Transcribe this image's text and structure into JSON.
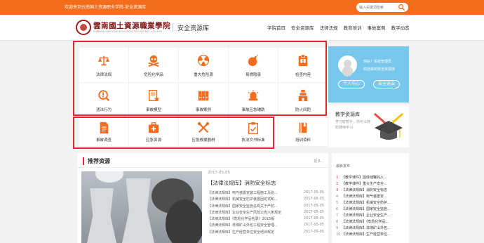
{
  "topbar": {
    "welcome": "欢迎来到云南国土资源职业学院-安全资源库",
    "search_placeholder": "输入关键词检索",
    "color": "#f36d1c"
  },
  "header": {
    "school_name": "雲南國土資源職業學院",
    "school_en": "YUNNAN LAND AND RESOURCES VOCATIONAL COLLEGE",
    "site_name": "安全资源库",
    "nav": [
      "学院首页",
      "安全资源库",
      "法律法规",
      "教育培训",
      "事故案例",
      "教学动态"
    ]
  },
  "tiles": [
    {
      "label": "法律法规",
      "icon": "scale-icon"
    },
    {
      "label": "危险化学品",
      "icon": "skull-crossbones-icon"
    },
    {
      "label": "重大危险源",
      "icon": "radiation-icon"
    },
    {
      "label": "易燃隐患",
      "icon": "bomb-icon"
    },
    {
      "label": "检查内容",
      "icon": "clipboard-check-icon"
    },
    {
      "label": "违法行为",
      "icon": "magnifier-warning-icon"
    },
    {
      "label": "事故模型",
      "icon": "document-star-icon"
    },
    {
      "label": "事故案例",
      "icon": "binders-icon"
    },
    {
      "label": "事故应急辅助",
      "icon": "alarm-light-icon"
    },
    {
      "label": "防火间距",
      "icon": "building-icon"
    },
    {
      "label": "事故调查",
      "icon": "report-document-icon"
    },
    {
      "label": "应急资源",
      "icon": "first-aid-kit-icon"
    },
    {
      "label": "应急救援器材",
      "icon": "tools-icon"
    },
    {
      "label": "执法文书标准",
      "icon": "clipboard-checklist-icon"
    },
    {
      "label": "培训资料",
      "icon": "book-bookmark-icon"
    }
  ],
  "user": {
    "greeting": "你好！系统管理员",
    "role": "欢迎来到安全资源库",
    "center_btn": "个人中心",
    "logout_btn": "安全退出"
  },
  "resource": {
    "title": "教学资源库",
    "desc": "学习好帮手，你可以随时随地学习"
  },
  "recommend": {
    "title": "推荐资源",
    "more": "更多...",
    "featured_date": "2017-05-05",
    "featured_title": "【法律法规库】消防安全标志",
    "items": [
      {
        "title": "【法律法规库】电气装置安装工程施工及验...",
        "date": "2017-05-05"
      },
      {
        "title": "【法律法规库】机械安全防护装置固定式和...",
        "date": "2017-05-05"
      },
      {
        "title": "【法律法规库】国家安全监管总局关于严防...",
        "date": "2017-05-05"
      },
      {
        "title": "【法律法规库】企业安全生产风险公告六条规定",
        "date": "2017-05-05"
      },
      {
        "title": "【法律法规库】《危险化学品名录》2015版",
        "date": "2017-05-05"
      },
      {
        "title": "【法律法规库】非煤矿山外包工程安全管理...",
        "date": "2017-05-05"
      },
      {
        "title": "【法律法规库】生产经营单位安全培训规定",
        "date": "2017-05-05"
      }
    ]
  },
  "latest": {
    "title": "最新发布",
    "items": [
      {
        "n": "1",
        "title": "【教学课件】固体储罐的火..."
      },
      {
        "n": "2",
        "title": "【教学课件】重大生产安全..."
      },
      {
        "n": "3",
        "title": "【法律法规库】消防安全标志"
      },
      {
        "n": "4",
        "title": "【法律法规库】电气装置安..."
      },
      {
        "n": "5",
        "title": "【法律法规库】机械安全防护..."
      },
      {
        "n": "6",
        "title": "【法律法规库】国家安全监管..."
      },
      {
        "n": "7",
        "title": "【法律法规库】企业安全生产..."
      },
      {
        "n": "8",
        "title": "【法律法规库】《危险化学品..."
      },
      {
        "n": "9",
        "title": "【法律法规库】非煤矿山外包..."
      },
      {
        "n": "10",
        "title": "【法律法规库】生产经营单位..."
      }
    ]
  }
}
